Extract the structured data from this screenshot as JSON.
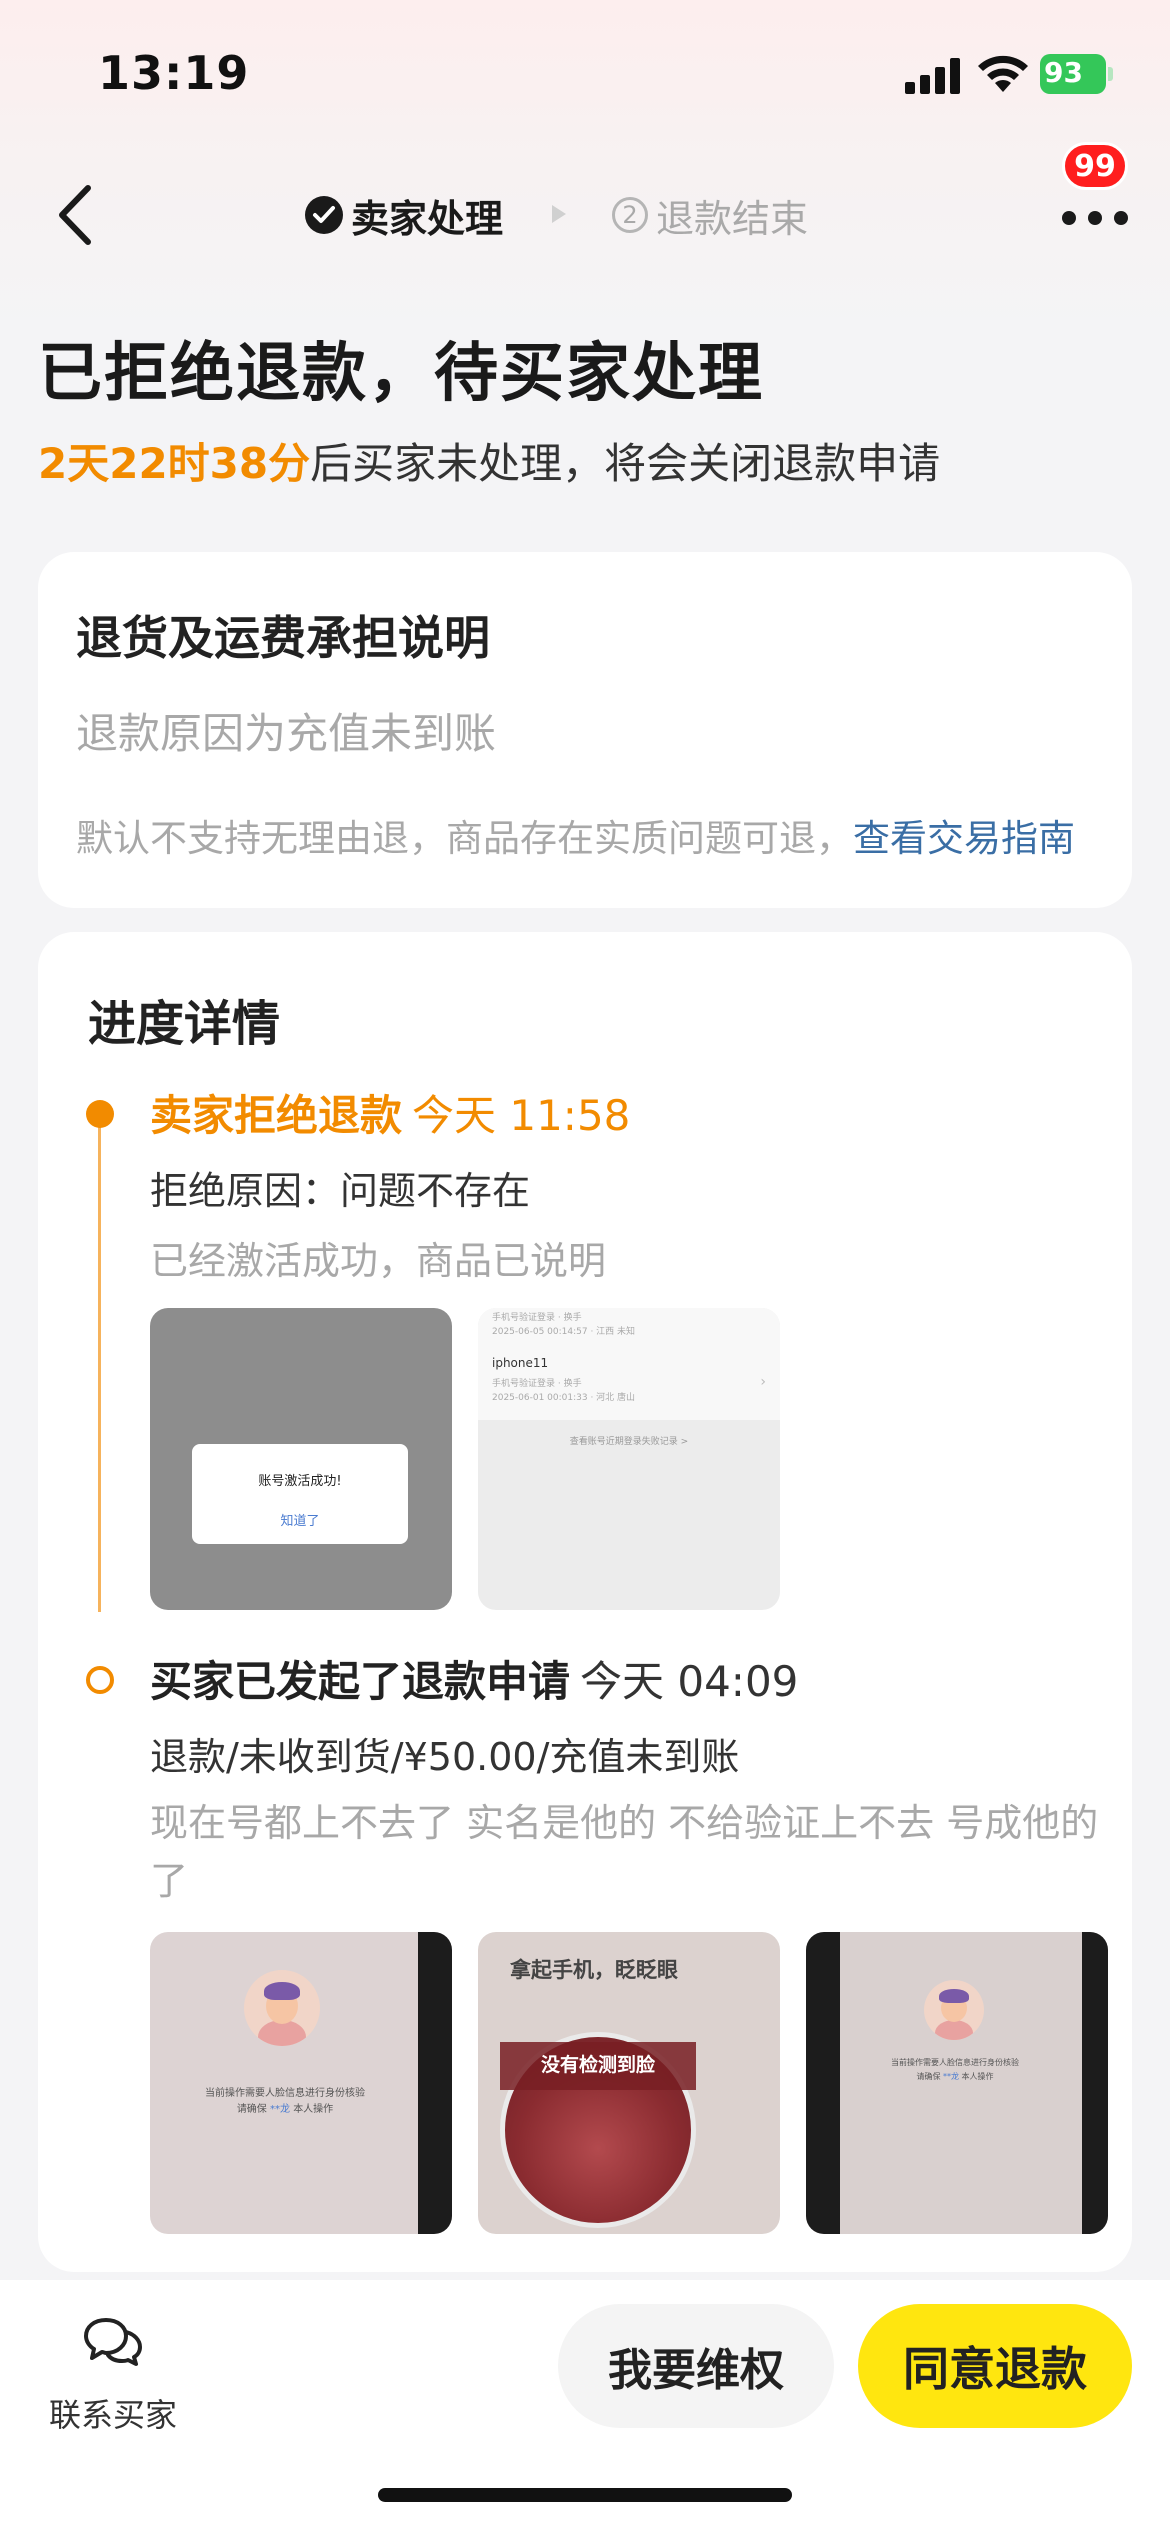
{
  "status_bar": {
    "time": "13:19",
    "battery": "93"
  },
  "nav": {
    "step1_label": "卖家处理",
    "step2_number": "2",
    "step2_label": "退款结束",
    "badge_count": "99"
  },
  "header": {
    "title": "已拒绝退款，待买家处理",
    "countdown": "2天22时38分",
    "countdown_suffix": "后买家未处理，将会关闭退款申请"
  },
  "return_info": {
    "title": "退货及运费承担说明",
    "reason": "退款原因为充值未到账",
    "note": "默认不支持无理由退，商品存在实质问题可退，",
    "link": "查看交易指南"
  },
  "progress": {
    "title": "进度详情",
    "events": [
      {
        "title": "卖家拒绝退款",
        "time": "今天 11:58",
        "line": "拒绝原因：问题不存在",
        "sub": "已经激活成功，商品已说明",
        "thumb1": {
          "dialog_title": "账号激活成功!",
          "dialog_button": "知道了"
        },
        "thumb2": {
          "row1": "手机号验证登录 · 换手",
          "row1_date": "2025-06-05 00:14:57 · 江西 未知",
          "name": "iphone11",
          "row2": "手机号验证登录 · 换手",
          "row2_date": "2025-06-01 00:01:33 · 河北 唐山",
          "link": "查看账号近期登录失败记录 >"
        }
      },
      {
        "title": "买家已发起了退款申请",
        "time": "今天 04:09",
        "line": "退款/未收到货/¥50.00/充值未到账",
        "sub": "现在号都上不去了 实名是他的 不给验证上不去 号成他的了",
        "thumb3": {
          "caption1": "当前操作需要人脸信息进行身份核验",
          "caption2_pre": "请确保",
          "caption2_hl": "**龙",
          "caption2_post": "本人操作"
        },
        "thumb4": {
          "title": "拿起手机，眨眨眼",
          "overlay": "没有检测到脸"
        },
        "thumb5": {
          "caption1": "当前操作需要人脸信息进行身份核验",
          "caption2_pre": "请确保",
          "caption2_hl": "**龙",
          "caption2_post": "本人操作"
        }
      }
    ]
  },
  "bottom": {
    "contact_label": "联系买家",
    "rights_button": "我要维权",
    "agree_button": "同意退款"
  },
  "colors": {
    "accent": "#f28b00",
    "primary_button": "#ffe60f",
    "link": "#3a6ea5",
    "badge": "#ff1e1e"
  }
}
